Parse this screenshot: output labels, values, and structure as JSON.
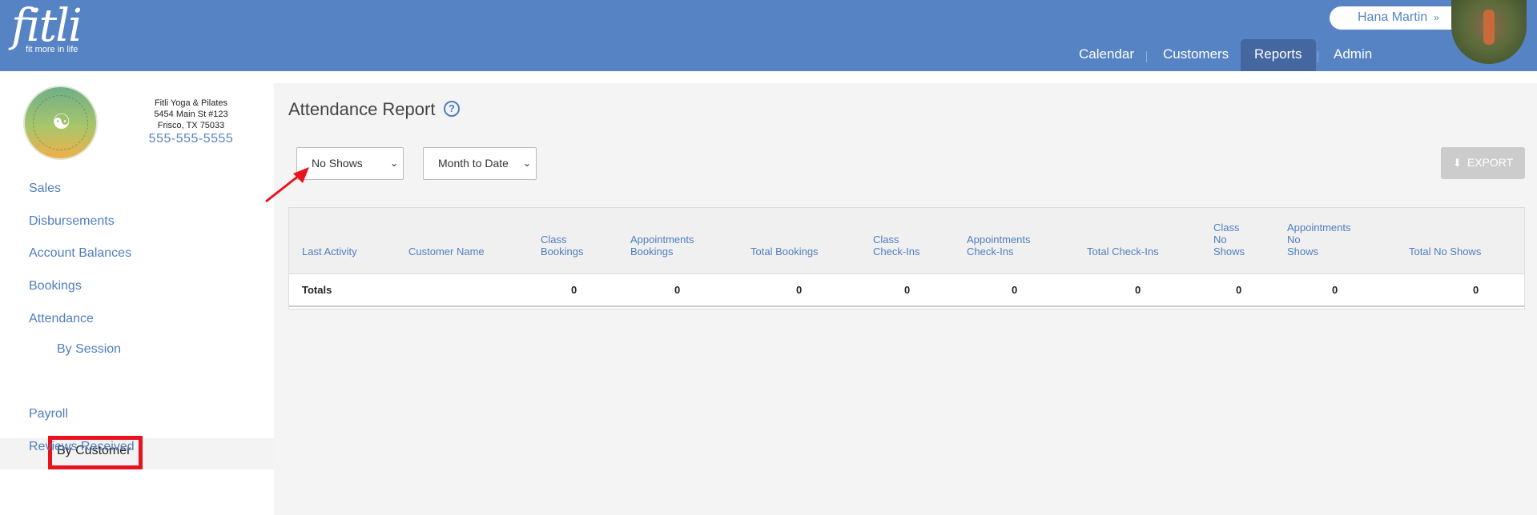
{
  "header": {
    "logo_word": "fitli",
    "logo_tagline": "fit more in life",
    "user_name": "Hana Martin",
    "user_chevron": "»",
    "nav": [
      "Calendar",
      "Customers",
      "Reports",
      "Admin"
    ],
    "nav_active": "Reports",
    "bg_color": "#5683c4"
  },
  "sidebar": {
    "business": {
      "name": "Fitli Yoga & Pilates",
      "address_line1": "5454 Main St #123",
      "address_line2": "Frisco, TX 75033",
      "phone": "555-555-5555"
    },
    "menu": [
      "Sales",
      "Disbursements",
      "Account Balances",
      "Bookings",
      "Attendance"
    ],
    "submenu": [
      "By Session",
      "By Customer"
    ],
    "submenu_active": "By Customer",
    "menu_after": [
      "Payroll",
      "Reviews Received"
    ]
  },
  "main": {
    "title": "Attendance Report",
    "help_icon": "question-icon",
    "filter_type": {
      "selected": "No Shows"
    },
    "filter_range": {
      "selected": "Month to Date"
    },
    "export_label": "EXPORT",
    "table": {
      "columns": [
        "Last Activity",
        "Customer Name",
        "Class\nBookings",
        "Appointments\nBookings",
        "Total Bookings",
        "Class\nCheck-Ins",
        "Appointments\nCheck-Ins",
        "Total Check-Ins",
        "Class\nNo\nShows",
        "Appointments\nNo\nShows",
        "Total No Shows"
      ],
      "totals_label": "Totals",
      "totals": [
        "0",
        "0",
        "0",
        "0",
        "0",
        "0",
        "0",
        "0",
        "0"
      ]
    }
  }
}
